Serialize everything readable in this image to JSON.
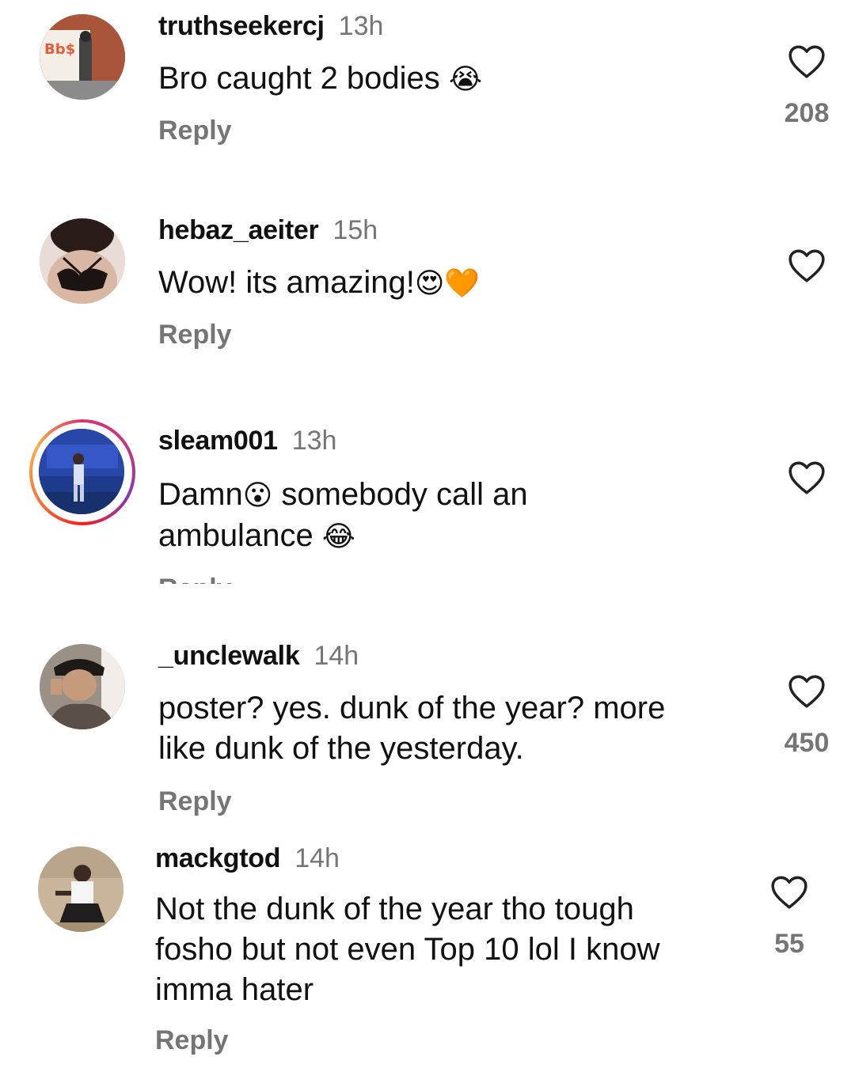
{
  "comments": [
    {
      "username": "truthseekercj",
      "time": "13h",
      "text_parts": [
        "Bro caught 2 bodies ",
        "😭"
      ],
      "reply_label": "Reply",
      "like_count": "208"
    },
    {
      "username": "hebaz_aeiter",
      "time": "15h",
      "text_parts": [
        "Wow! its amazing!",
        "😍🧡"
      ],
      "reply_label": "Reply",
      "like_count": ""
    },
    {
      "username": "sleam001",
      "time": "13h",
      "text_line1": [
        "Damn",
        "😮",
        " somebody call an"
      ],
      "text_line2": [
        "ambulance ",
        "😂"
      ],
      "reply_label": "Reply",
      "like_count": ""
    },
    {
      "username": "_unclewalk",
      "time": "14h",
      "text": "poster? yes. dunk of the year? more like dunk of the yesterday.",
      "reply_label": "Reply",
      "like_count": "450"
    },
    {
      "username": "mackgtod",
      "time": "14h",
      "text": "Not the dunk of the year tho tough fosho but not even Top 10 lol I know imma hater",
      "reply_label": "Reply",
      "like_count": "55"
    }
  ],
  "icons": {
    "like": "heart-outline-icon"
  },
  "colors": {
    "text": "#111111",
    "secondary": "#757575",
    "story_ring": "#e1306c"
  }
}
